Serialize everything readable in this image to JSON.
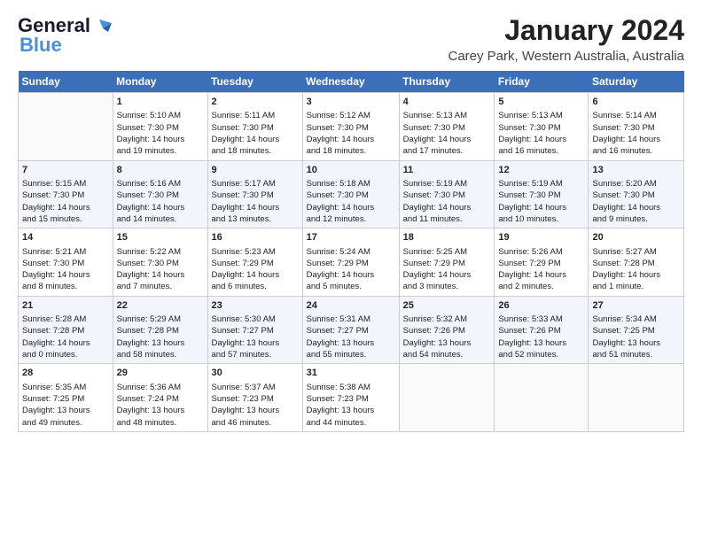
{
  "header": {
    "logo_general": "General",
    "logo_blue": "Blue",
    "title": "January 2024",
    "location": "Carey Park, Western Australia, Australia"
  },
  "columns": [
    "Sunday",
    "Monday",
    "Tuesday",
    "Wednesday",
    "Thursday",
    "Friday",
    "Saturday"
  ],
  "weeks": [
    [
      {
        "day": "",
        "info": ""
      },
      {
        "day": "1",
        "info": "Sunrise: 5:10 AM\nSunset: 7:30 PM\nDaylight: 14 hours\nand 19 minutes."
      },
      {
        "day": "2",
        "info": "Sunrise: 5:11 AM\nSunset: 7:30 PM\nDaylight: 14 hours\nand 18 minutes."
      },
      {
        "day": "3",
        "info": "Sunrise: 5:12 AM\nSunset: 7:30 PM\nDaylight: 14 hours\nand 18 minutes."
      },
      {
        "day": "4",
        "info": "Sunrise: 5:13 AM\nSunset: 7:30 PM\nDaylight: 14 hours\nand 17 minutes."
      },
      {
        "day": "5",
        "info": "Sunrise: 5:13 AM\nSunset: 7:30 PM\nDaylight: 14 hours\nand 16 minutes."
      },
      {
        "day": "6",
        "info": "Sunrise: 5:14 AM\nSunset: 7:30 PM\nDaylight: 14 hours\nand 16 minutes."
      }
    ],
    [
      {
        "day": "7",
        "info": "Sunrise: 5:15 AM\nSunset: 7:30 PM\nDaylight: 14 hours\nand 15 minutes."
      },
      {
        "day": "8",
        "info": "Sunrise: 5:16 AM\nSunset: 7:30 PM\nDaylight: 14 hours\nand 14 minutes."
      },
      {
        "day": "9",
        "info": "Sunrise: 5:17 AM\nSunset: 7:30 PM\nDaylight: 14 hours\nand 13 minutes."
      },
      {
        "day": "10",
        "info": "Sunrise: 5:18 AM\nSunset: 7:30 PM\nDaylight: 14 hours\nand 12 minutes."
      },
      {
        "day": "11",
        "info": "Sunrise: 5:19 AM\nSunset: 7:30 PM\nDaylight: 14 hours\nand 11 minutes."
      },
      {
        "day": "12",
        "info": "Sunrise: 5:19 AM\nSunset: 7:30 PM\nDaylight: 14 hours\nand 10 minutes."
      },
      {
        "day": "13",
        "info": "Sunrise: 5:20 AM\nSunset: 7:30 PM\nDaylight: 14 hours\nand 9 minutes."
      }
    ],
    [
      {
        "day": "14",
        "info": "Sunrise: 5:21 AM\nSunset: 7:30 PM\nDaylight: 14 hours\nand 8 minutes."
      },
      {
        "day": "15",
        "info": "Sunrise: 5:22 AM\nSunset: 7:30 PM\nDaylight: 14 hours\nand 7 minutes."
      },
      {
        "day": "16",
        "info": "Sunrise: 5:23 AM\nSunset: 7:29 PM\nDaylight: 14 hours\nand 6 minutes."
      },
      {
        "day": "17",
        "info": "Sunrise: 5:24 AM\nSunset: 7:29 PM\nDaylight: 14 hours\nand 5 minutes."
      },
      {
        "day": "18",
        "info": "Sunrise: 5:25 AM\nSunset: 7:29 PM\nDaylight: 14 hours\nand 3 minutes."
      },
      {
        "day": "19",
        "info": "Sunrise: 5:26 AM\nSunset: 7:29 PM\nDaylight: 14 hours\nand 2 minutes."
      },
      {
        "day": "20",
        "info": "Sunrise: 5:27 AM\nSunset: 7:28 PM\nDaylight: 14 hours\nand 1 minute."
      }
    ],
    [
      {
        "day": "21",
        "info": "Sunrise: 5:28 AM\nSunset: 7:28 PM\nDaylight: 14 hours\nand 0 minutes."
      },
      {
        "day": "22",
        "info": "Sunrise: 5:29 AM\nSunset: 7:28 PM\nDaylight: 13 hours\nand 58 minutes."
      },
      {
        "day": "23",
        "info": "Sunrise: 5:30 AM\nSunset: 7:27 PM\nDaylight: 13 hours\nand 57 minutes."
      },
      {
        "day": "24",
        "info": "Sunrise: 5:31 AM\nSunset: 7:27 PM\nDaylight: 13 hours\nand 55 minutes."
      },
      {
        "day": "25",
        "info": "Sunrise: 5:32 AM\nSunset: 7:26 PM\nDaylight: 13 hours\nand 54 minutes."
      },
      {
        "day": "26",
        "info": "Sunrise: 5:33 AM\nSunset: 7:26 PM\nDaylight: 13 hours\nand 52 minutes."
      },
      {
        "day": "27",
        "info": "Sunrise: 5:34 AM\nSunset: 7:25 PM\nDaylight: 13 hours\nand 51 minutes."
      }
    ],
    [
      {
        "day": "28",
        "info": "Sunrise: 5:35 AM\nSunset: 7:25 PM\nDaylight: 13 hours\nand 49 minutes."
      },
      {
        "day": "29",
        "info": "Sunrise: 5:36 AM\nSunset: 7:24 PM\nDaylight: 13 hours\nand 48 minutes."
      },
      {
        "day": "30",
        "info": "Sunrise: 5:37 AM\nSunset: 7:23 PM\nDaylight: 13 hours\nand 46 minutes."
      },
      {
        "day": "31",
        "info": "Sunrise: 5:38 AM\nSunset: 7:23 PM\nDaylight: 13 hours\nand 44 minutes."
      },
      {
        "day": "",
        "info": ""
      },
      {
        "day": "",
        "info": ""
      },
      {
        "day": "",
        "info": ""
      }
    ]
  ]
}
